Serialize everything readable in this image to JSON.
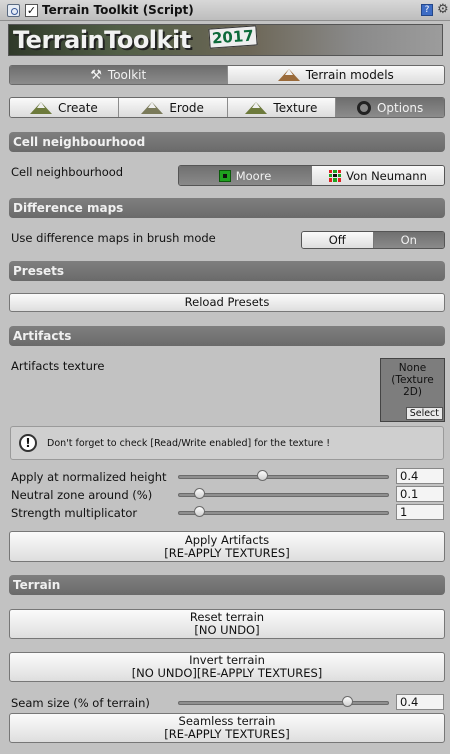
{
  "header": {
    "title": "Terrain Toolkit (Script)",
    "checkbox": "✓",
    "help": "?",
    "settings_glyph": "⚙"
  },
  "banner": {
    "logo": "TerrainToolkit",
    "year": "2017"
  },
  "main_tabs": [
    {
      "label": "Toolkit",
      "icon": "tools-icon",
      "active": true
    },
    {
      "label": "Terrain models",
      "icon": "terrain-models-icon",
      "active": false
    }
  ],
  "sub_tabs": [
    {
      "label": "Create",
      "icon": "mountain-icon"
    },
    {
      "label": "Erode",
      "icon": "erode-icon"
    },
    {
      "label": "Texture",
      "icon": "texture-icon"
    },
    {
      "label": "Options",
      "icon": "options-icon",
      "active": true
    }
  ],
  "cell": {
    "section": "Cell neighbourhood",
    "label": "Cell neighbourhood",
    "moore": "Moore",
    "von_neumann": "Von Neumann",
    "selected": "Moore"
  },
  "difference": {
    "section": "Difference maps",
    "label": "Use difference maps in brush mode",
    "off": "Off",
    "on": "On",
    "selected": "On"
  },
  "presets": {
    "section": "Presets",
    "reload": "Reload Presets"
  },
  "artifacts": {
    "section": "Artifacts",
    "texture_label": "Artifacts texture",
    "texture_value_line1": "None",
    "texture_value_line2": "(Texture",
    "texture_value_line3": "2D)",
    "select": "Select",
    "info": "Don't forget to check [Read/Write enabled] for the texture !",
    "info_glyph": "!",
    "sliders": [
      {
        "label": "Apply at normalized height",
        "value": "0.4",
        "fraction": 0.4
      },
      {
        "label": "Neutral zone around (%)",
        "value": "0.1",
        "fraction": 0.1
      },
      {
        "label": "Strength multiplicator",
        "value": "1",
        "fraction": 0.1
      }
    ],
    "apply_line1": "Apply Artifacts",
    "apply_line2": "[RE-APPLY TEXTURES]"
  },
  "terrain": {
    "section": "Terrain",
    "reset_line1": "Reset terrain",
    "reset_line2": "[NO UNDO]",
    "invert_line1": "Invert terrain",
    "invert_line2": "[NO UNDO][RE-APPLY TEXTURES]",
    "seam_label": "Seam size (% of terrain)",
    "seam_value": "0.4",
    "seam_fraction": 0.8,
    "seamless_line1": "Seamless terrain",
    "seamless_line2": "[RE-APPLY TEXTURES]"
  },
  "colors": {
    "section_bg": "#757575",
    "active_tab": "#7a7a7a",
    "moore_green": "#1fa11f",
    "vn_red": "#dd2222"
  }
}
